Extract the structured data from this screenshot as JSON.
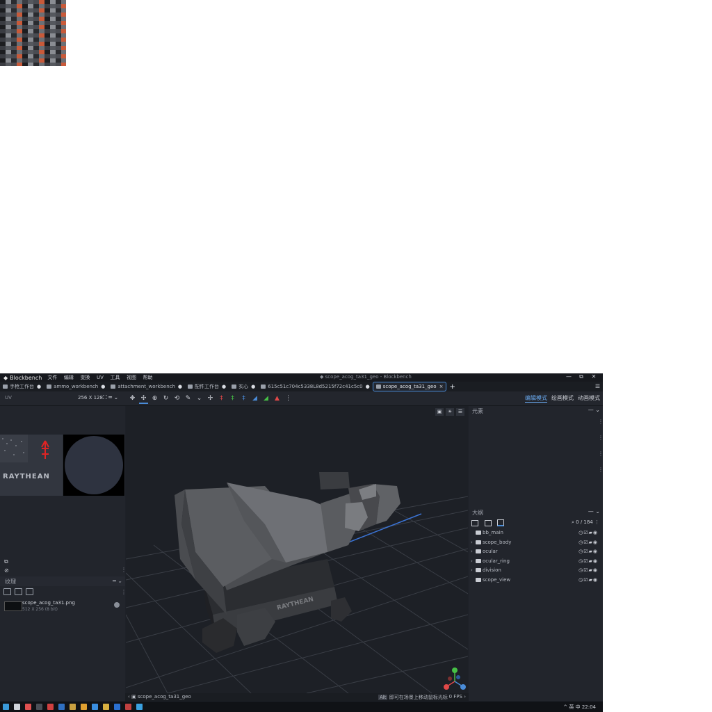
{
  "titlebar": {
    "app_name": "Blockbench",
    "menu": [
      "文件",
      "编辑",
      "变换",
      "UV",
      "工具",
      "视图",
      "帮助"
    ],
    "window_title": "◆ scope_acog_ta31_geo - Blockbench",
    "controls": [
      "—",
      "⧉",
      "✕"
    ]
  },
  "tabs": [
    {
      "label": "手枪工作台",
      "icon": "workbench-icon"
    },
    {
      "label": "ammo_workbench",
      "icon": "workbench-icon"
    },
    {
      "label": "attachment_workbench",
      "icon": "workbench-icon"
    },
    {
      "label": "配件工作台",
      "icon": "workbench-icon"
    },
    {
      "label": "实心",
      "icon": "image-icon"
    },
    {
      "label": "615c51c704c5338L8d5215f72c41c5c0",
      "icon": "image-icon"
    },
    {
      "label": "scope_acog_ta31_geo",
      "icon": "model-icon",
      "active": true
    }
  ],
  "toolbar": {
    "uv_label": "UV",
    "uv_size": "256 X 128",
    "tools": [
      "move-tool",
      "resize-tool",
      "rotate-tool",
      "pivot-tool",
      "vertex-snap-tool",
      "paint-tool",
      "brush-tool"
    ],
    "mirror_tools": [
      "mirror-x",
      "mirror-y",
      "mirror-z",
      "flip-x",
      "flip-y",
      "flip-z"
    ],
    "modes": [
      "编辑模式",
      "绘画模式",
      "动画模式"
    ],
    "active_mode": "编辑模式"
  },
  "left_panel": {
    "uv_logo": "RAYTHEAN",
    "textures_header": "纹理",
    "texture_item": {
      "name": "scope_acog_ta31.png",
      "info": "512 X 256 (8 bit)"
    }
  },
  "right_panel": {
    "elements_header": "元素",
    "outliner_header": "大纲",
    "count": "0 / 184",
    "outliner": [
      {
        "name": "bb_main",
        "expandable": false
      },
      {
        "name": "scope_body",
        "expandable": true
      },
      {
        "name": "ocular",
        "expandable": true
      },
      {
        "name": "ocular_ring",
        "expandable": true
      },
      {
        "name": "division",
        "expandable": true
      },
      {
        "name": "scope_view",
        "expandable": false
      }
    ]
  },
  "viewport": {
    "model_logo": "RAYTHEAN",
    "view_buttons": [
      "camera-icon",
      "light-icon",
      "menu-icon"
    ]
  },
  "statusbar": {
    "model_name": "scope_acog_ta31_geo",
    "hint_key": "Alt",
    "hint": "即可在场景上移动鼠标光标",
    "fps": "0 FPS"
  },
  "taskbar": {
    "time": "22:04",
    "tray": "^ 英 中"
  },
  "colors": {
    "accent": "#4a8cd8",
    "background": "#1e2128",
    "panel": "#22252c",
    "viewport": "#1d2026"
  }
}
